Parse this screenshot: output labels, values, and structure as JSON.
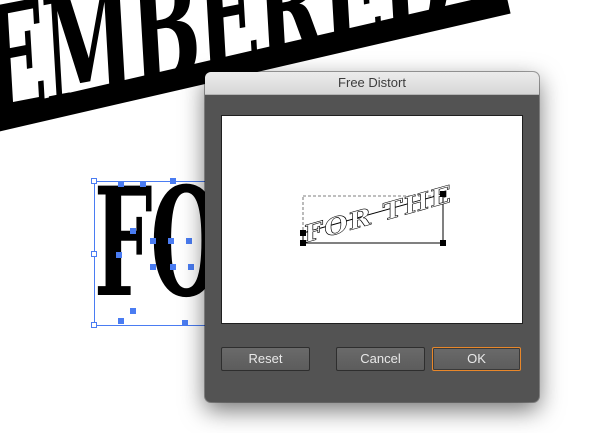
{
  "artboard": {
    "top_text": "EMBERED",
    "selected_text": "FO"
  },
  "dialog": {
    "title": "Free Distort",
    "preview": {
      "text": "FOR THE"
    },
    "buttons": {
      "reset_label": "Reset",
      "cancel_label": "Cancel",
      "ok_label": "OK"
    }
  },
  "colors": {
    "dialog_bg": "#535353",
    "selection_blue": "#4a7cf2",
    "ok_border": "#e8872a"
  }
}
